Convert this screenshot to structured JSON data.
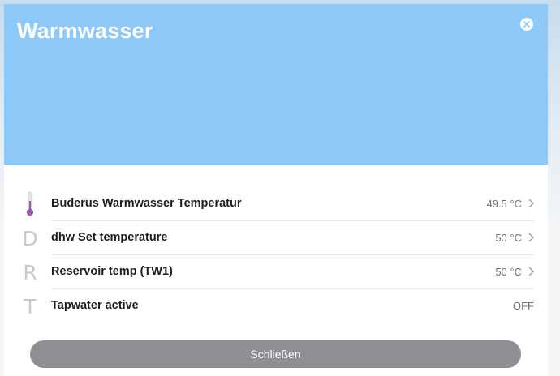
{
  "dialog": {
    "title": "Warmwasser",
    "close_icon": "close-icon",
    "colors": {
      "header": "#8cc8f8",
      "button": "#8e8e93",
      "thermometer": "#9b59b6"
    }
  },
  "entities": [
    {
      "icon": "thermometer-icon",
      "letter": "",
      "name": "Buderus Warmwasser Temperatur",
      "value": "49.5 °C",
      "has_arrow": true
    },
    {
      "icon": "",
      "letter": "D",
      "name": "dhw Set temperature",
      "value": "50 °C",
      "has_arrow": true
    },
    {
      "icon": "",
      "letter": "R",
      "name": "Reservoir temp (TW1)",
      "value": "50 °C",
      "has_arrow": true
    },
    {
      "icon": "",
      "letter": "T",
      "name": "Tapwater active",
      "value": "OFF",
      "has_arrow": false
    }
  ],
  "footer": {
    "close_label": "Schließen"
  }
}
